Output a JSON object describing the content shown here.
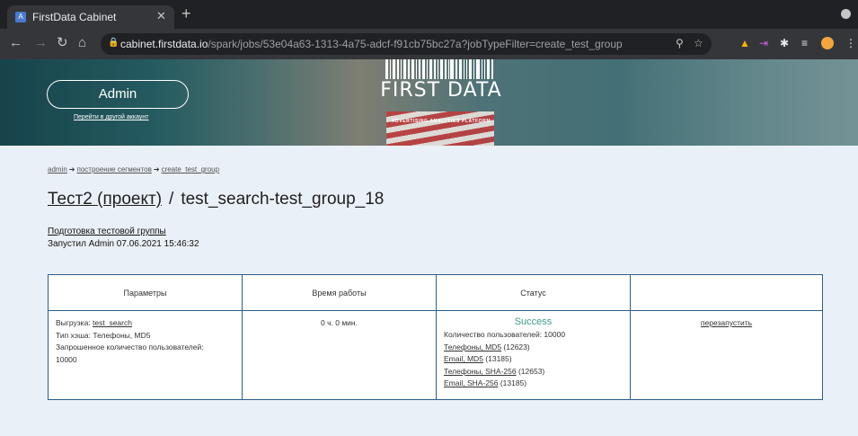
{
  "browser": {
    "tab_title": "FirstData Cabinet",
    "favicon_letter": "A",
    "url_host": "cabinet.firstdata.io",
    "url_path": "/spark/jobs/53e04a63-1313-4a75-adcf-f91cb75bc27a?jobTypeFilter=create_test_group"
  },
  "header": {
    "account_button": "Admin",
    "switch_account_link": "Перейти в другой аккаунт",
    "logo_text": "FIRST DATA",
    "logo_subtitle": "ADVERTISING ANALYTICS PLATFORM"
  },
  "breadcrumb": {
    "items": [
      "admin",
      "построение сегментов",
      "create_test_group"
    ]
  },
  "page": {
    "project_link": "Тест2 (проект)",
    "separator": "/",
    "title": "test_search-test_group_18",
    "job_type_link": "Подготовка тестовой группы",
    "launched_by": "Запустил Admin 07.06.2021 15:46:32"
  },
  "table": {
    "headers": [
      "Параметры",
      "Время работы",
      "Статус",
      ""
    ],
    "params": {
      "upload_label": "Выгрузка: ",
      "upload_link": "test_search",
      "hash_type": "Тип хэша: Телефоны, MD5",
      "requested_label": "Запрошенное количество пользователей:",
      "requested_value": "10000"
    },
    "runtime": "0 ч. 0 мин.",
    "status": {
      "state": "Success",
      "users_count": "Количество пользователей: 10000",
      "results": [
        {
          "link": "Телефоны, MD5",
          "count": " (12623)"
        },
        {
          "link": "Email, MD5",
          "count": " (13185)"
        },
        {
          "link": "Телефоны, SHA-256",
          "count": " (12653)"
        },
        {
          "link": "Email, SHA-256",
          "count": " (13185)"
        }
      ]
    },
    "restart_link": "перезапустить"
  },
  "colors": {
    "header_link": "#2c5f8a",
    "success": "#3b9a8a",
    "page_bg": "#eaf0f7"
  }
}
